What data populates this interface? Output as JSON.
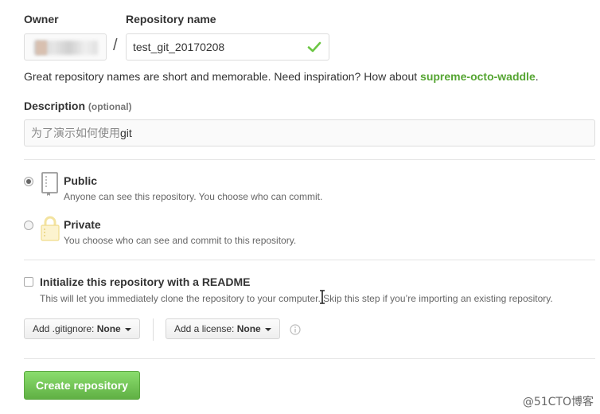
{
  "form": {
    "owner_label": "Owner",
    "repo_label": "Repository name",
    "separator": "/",
    "repo_name_value": "test_git_20170208",
    "hint_prefix": "Great repository names are short and memorable. Need inspiration? How about ",
    "hint_suggestion": "supreme-octo-waddle",
    "hint_suffix": ".",
    "description_label": "Description",
    "description_optional": "(optional)",
    "description_value_cjk": "为了演示如何使用",
    "description_value_latin": "git"
  },
  "visibility": {
    "public": {
      "title": "Public",
      "desc": "Anyone can see this repository. You choose who can commit.",
      "selected": true
    },
    "private": {
      "title": "Private",
      "desc": "You choose who can see and commit to this repository.",
      "selected": false
    }
  },
  "readme": {
    "title": "Initialize this repository with a README",
    "desc": "This will let you immediately clone the repository to your computer. Skip this step if you’re importing an existing repository.",
    "checked": false
  },
  "addons": {
    "gitignore_prefix": "Add .gitignore:",
    "gitignore_value": "None",
    "license_prefix": "Add a license:",
    "license_value": "None"
  },
  "actions": {
    "create_label": "Create repository"
  },
  "watermark": "@51CTO博客",
  "colors": {
    "accent_green": "#55a532",
    "button_green": "#60b044",
    "check_green": "#6cc644"
  }
}
